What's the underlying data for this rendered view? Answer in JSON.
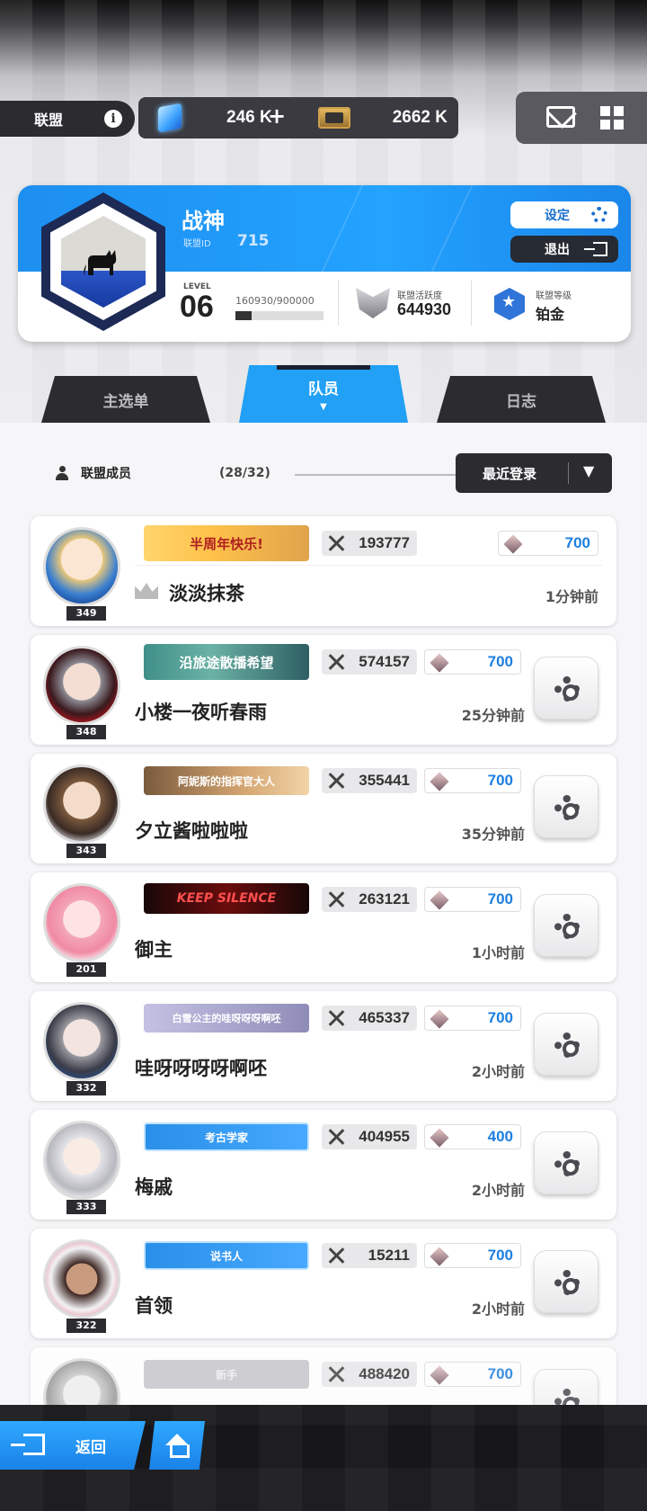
{
  "header": {
    "union_tab_label": "联盟",
    "info_symbol": "i",
    "gems_value": "246 K",
    "gems_plus": "+",
    "tickets_value": "2662 K"
  },
  "union": {
    "name": "战神",
    "id_label": "联盟ID",
    "id_value": "715",
    "settings_label": "设定",
    "exit_label": "退出",
    "level_label": "LEVEL",
    "level_value": "06",
    "exp_text": "160930/900000",
    "exp_progress": 0.179,
    "activity_label": "联盟活跃度",
    "activity_value": "644930",
    "rank_label": "联盟等级",
    "rank_value": "铂金"
  },
  "tabs": [
    {
      "label": "主选单"
    },
    {
      "label": "队员",
      "active": true,
      "indicator": "▼"
    },
    {
      "label": "日志"
    }
  ],
  "members": {
    "heading": "联盟成员",
    "count": "(28/32)",
    "sort_label": "最近登录",
    "sort_arrow": "▼",
    "list": [
      {
        "level": "349",
        "title": "半周年快乐!",
        "power": "193777",
        "contribution": "700",
        "name": "淡淡抹茶",
        "time": "1分钟前"
      },
      {
        "level": "348",
        "title": "沿旅途散播希望",
        "power": "574157",
        "contribution": "700",
        "name": "小楼一夜听春雨",
        "time": "25分钟前"
      },
      {
        "level": "343",
        "title": "阿妮斯的指挥官大人",
        "power": "355441",
        "contribution": "700",
        "name": "夕立酱啦啦啦",
        "time": "35分钟前"
      },
      {
        "level": "201",
        "title": "KEEP SILENCE",
        "power": "263121",
        "contribution": "700",
        "name": "御主",
        "time": "1小时前"
      },
      {
        "level": "332",
        "title": "白雪公主的哇呀呀呀啊呸",
        "power": "465337",
        "contribution": "700",
        "name": "哇呀呀呀呀啊呸",
        "time": "2小时前"
      },
      {
        "level": "333",
        "title": "考古学家",
        "power": "404955",
        "contribution": "400",
        "name": "梅戚",
        "time": "2小时前"
      },
      {
        "level": "322",
        "title": "说书人",
        "power": "15211",
        "contribution": "700",
        "name": "首领",
        "time": "2小时前"
      },
      {
        "level": "",
        "title": "新手",
        "power": "488420",
        "contribution": "700",
        "name": "",
        "time": ""
      }
    ]
  },
  "footer": {
    "back_label": "返回"
  }
}
